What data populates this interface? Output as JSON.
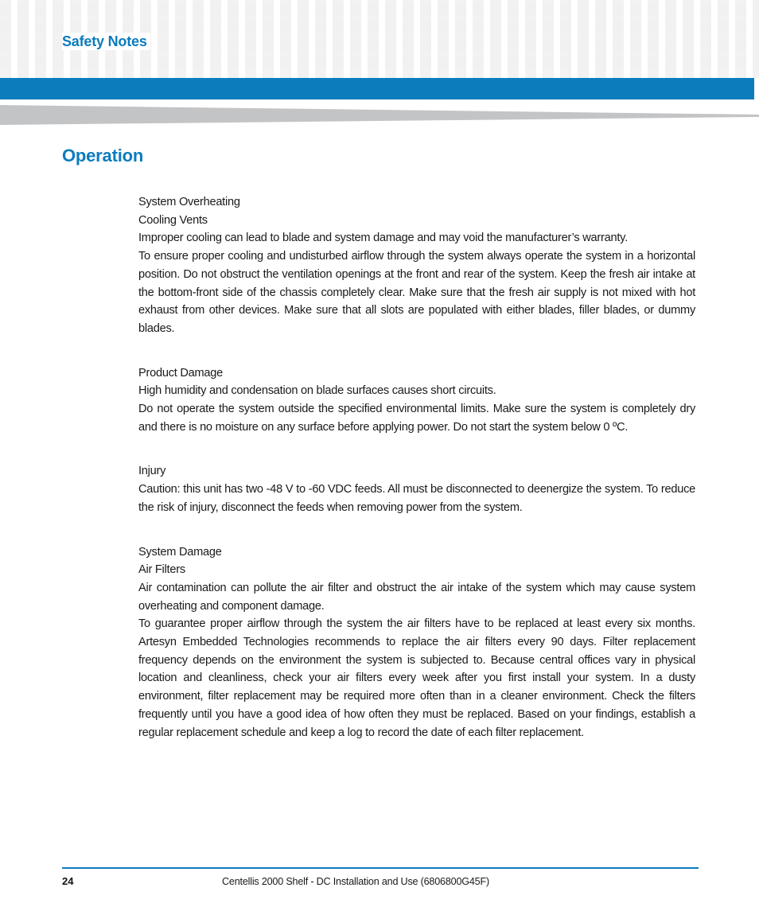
{
  "header": {
    "title": "Safety Notes",
    "accent_color": "#0c7cbd",
    "grid_square_color": "#f1f1f2",
    "swoosh_color": "#c3c4c6"
  },
  "page": {
    "heading": "Operation"
  },
  "sections": [
    {
      "id": "system-overheating",
      "lines": [
        "System Overheating",
        "Cooling Vents"
      ],
      "paragraphs": [
        "Improper cooling can lead to blade and system damage and may void the manufacturer’s warranty.",
        "To ensure proper cooling and undisturbed airflow through the system always operate the system in a horizontal position. Do not obstruct the ventilation openings at the front and rear of the system. Keep the fresh air intake at the bottom-front side of the chassis completely clear. Make sure that the fresh air supply is not mixed with hot exhaust from other devices. Make sure that all slots are populated with either blades, filler blades, or dummy blades."
      ]
    },
    {
      "id": "product-damage",
      "lines": [
        "Product Damage"
      ],
      "paragraphs": [
        "High humidity and condensation on blade surfaces causes short circuits.",
        "Do not operate the system outside the specified environmental limits. Make sure the system is completely dry and there is no moisture on any surface before applying power. Do not start the system below 0 ºC."
      ]
    },
    {
      "id": "injury",
      "lines": [
        "Injury"
      ],
      "paragraphs": [
        "Caution: this unit has two -48 V to -60 VDC feeds. All must be disconnected to deenergize the system. To reduce the risk of injury, disconnect the feeds when removing power from the system."
      ]
    },
    {
      "id": "system-damage",
      "lines": [
        "System Damage",
        "Air Filters"
      ],
      "paragraphs": [
        "Air contamination can pollute the air filter and obstruct the air intake of the system which may cause system overheating and component damage.",
        "To guarantee proper airflow through the system the air filters have to be replaced at least every six months. Artesyn Embedded Technologies recommends to replace the air filters every 90 days. Filter replacement frequency depends on the environment the system is subjected to. Because central offices vary in physical location and cleanliness, check your air filters every week after you first install your system. In a dusty environment, filter replacement may be required more often than in a cleaner environment. Check the filters frequently until you have a good idea of how often they must be replaced. Based on your findings, establish a regular replacement schedule and keep a log to record the date of each filter replacement."
      ]
    }
  ],
  "footer": {
    "page_number": "24",
    "document_title": "Centellis 2000 Shelf - DC Installation and Use (6806800G45F)"
  }
}
